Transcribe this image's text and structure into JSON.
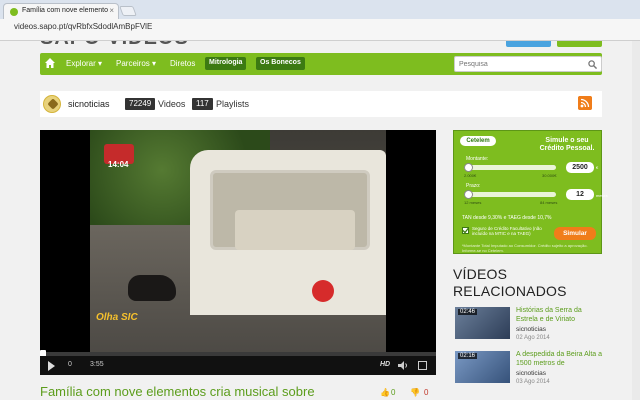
{
  "browser": {
    "tab_title": "Família com nove elemento",
    "url": "videos.sapo.pt/qvRbfxSdodlAmBpFVlE"
  },
  "nav": {
    "items": [
      "Explorar ▾",
      "Parceiros ▾",
      "Diretos"
    ],
    "pills": [
      "Mitrologia",
      "Os Bonecos"
    ],
    "search_placeholder": "Pesquisa"
  },
  "channel": {
    "name": "sicnoticias",
    "videos_count": "72249",
    "videos_label": "Videos",
    "playlists_count": "117",
    "playlists_label": "Playlists"
  },
  "player": {
    "clock": "14:04",
    "current_time": "0",
    "duration": "3:55",
    "hd_label": "HD",
    "progress": 0.0,
    "corner_logo": "Olha SIC"
  },
  "video": {
    "title": "Família com nove elementos cria musical sobre",
    "likes": "0",
    "dislikes": "0"
  },
  "ad": {
    "brand": "Cetelem",
    "headline": "Simule o seu Crédito Pessoal.",
    "montante_label": "Montante:",
    "montante_min": "2.000€",
    "montante_max": "30.000€",
    "montante_value": "2500",
    "montante_unit": "€",
    "prazo_label": "Prazo:",
    "prazo_min": "12 meses",
    "prazo_max": "84 meses",
    "prazo_value": "12",
    "prazo_unit": "meses",
    "tan": "TAN desde 9,30% e TAEG desde 10,7%",
    "checkbox_text": "Seguro de Crédito Facultativo (não incluído na MTIC e na TAEG)",
    "footnote": "*Montante Total Imputado ao Consumidor. Crédito sujeito a aprovação. Informe-se no Cetelem.",
    "button": "Simular",
    "checked": true
  },
  "related": {
    "heading": "VÍDEOS RELACIONADOS",
    "items": [
      {
        "duration": "02:46",
        "title": "Histórias da Serra da Estrela e de Viriato",
        "channel": "sicnoticias",
        "date": "02 Ago 2014"
      },
      {
        "duration": "02:16",
        "title": "A despedida da Beira Alta a 1500 metros de",
        "channel": "sicnoticias",
        "date": "03 Ago 2014"
      }
    ]
  },
  "colors": {
    "brand_green": "#7ebd1f",
    "title_green": "#5c9d1c",
    "rss_orange": "#f07d1a"
  }
}
